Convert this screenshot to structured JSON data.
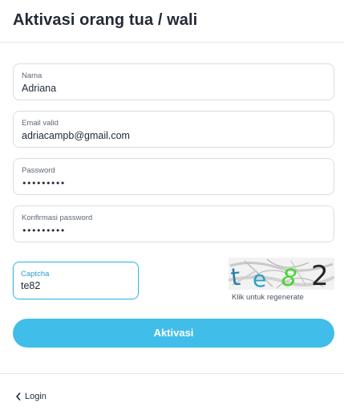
{
  "header": {
    "title": "Aktivasi orang tua / wali"
  },
  "form": {
    "nama": {
      "label": "Nama",
      "value": "Adriana"
    },
    "email": {
      "label": "Email valid",
      "value": "adriacampb@gmail.com"
    },
    "password": {
      "label": "Password",
      "value": "•••••••••"
    },
    "confirm": {
      "label": "Konfirmasi password",
      "value": "•••••••••"
    },
    "captcha": {
      "label": "Captcha",
      "value": "te82",
      "image_text": "te82",
      "hint": "Klik untuk regenerate"
    },
    "submit_label": "Aktivasi"
  },
  "footer": {
    "back_label": "Login",
    "back_icon": "chevron-left-icon"
  },
  "colors": {
    "accent": "#41bdea",
    "focus_border": "#3fb8e6",
    "border": "#d8dde3"
  }
}
